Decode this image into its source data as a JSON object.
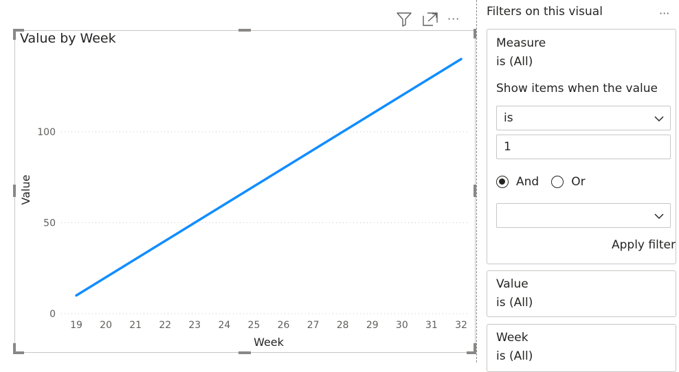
{
  "visual": {
    "title": "Value by Week",
    "header_icons": [
      "filter-icon",
      "focus-mode-icon",
      "more-options-icon"
    ],
    "more_label": "···"
  },
  "chart_data": {
    "type": "line",
    "title": "Value by Week",
    "xlabel": "Week",
    "ylabel": "Value",
    "x": [
      19,
      20,
      21,
      22,
      23,
      24,
      25,
      26,
      27,
      28,
      29,
      30,
      31,
      32
    ],
    "series": [
      {
        "values": [
          10,
          20,
          30,
          40,
          50,
          60,
          70,
          80,
          90,
          100,
          110,
          120,
          130,
          140
        ],
        "color": "#118DFF"
      }
    ],
    "y_ticks": [
      0,
      50,
      100
    ],
    "ylim": [
      0,
      140
    ],
    "grid": "horizontal dotted",
    "legend": "none"
  },
  "filter_pane": {
    "title": "Filters on this visual",
    "more_label": "···",
    "cards": {
      "measure": {
        "title": "Measure",
        "summary": "is (All)",
        "show_items_label": "Show items when the value",
        "condition1_operator": "is",
        "condition1_value": "1",
        "and_label": "And",
        "or_label": "Or",
        "logic_selected": "And",
        "condition2_operator": "",
        "apply_label": "Apply filter"
      },
      "value": {
        "title": "Value",
        "summary": "is (All)"
      },
      "week": {
        "title": "Week",
        "summary": "is (All)"
      }
    }
  },
  "colors": {
    "line": "#118DFF",
    "border": "#C8C6C4",
    "text": "#252423",
    "muted": "#605E5C"
  }
}
